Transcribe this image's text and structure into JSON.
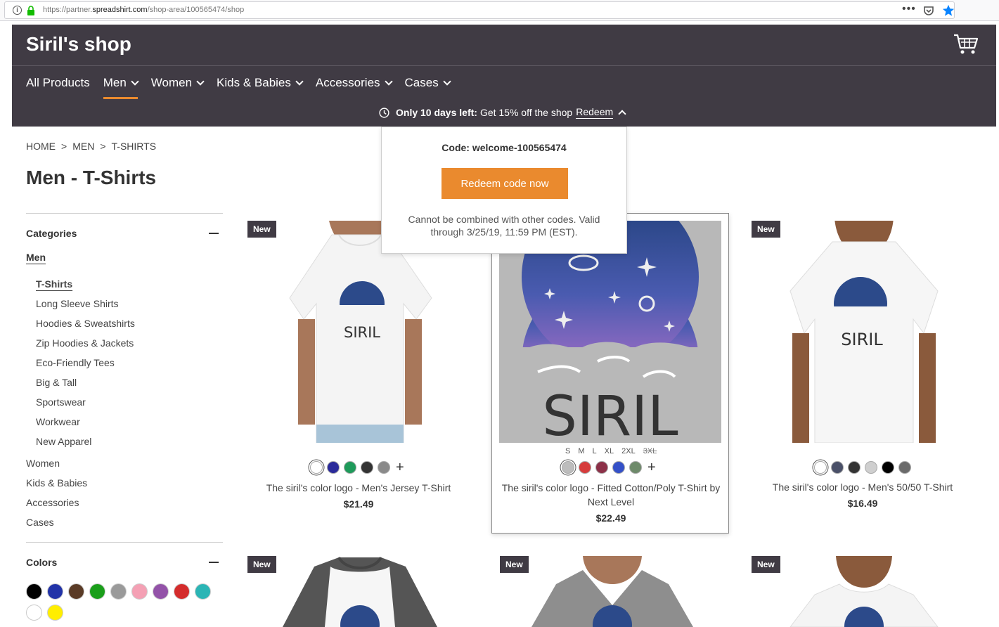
{
  "browser": {
    "url_prefix": "https://partner.",
    "url_domain": "spreadshirt.com",
    "url_path": "/shop-area/100565474/shop",
    "menu_dots": "•••"
  },
  "header": {
    "shop_title": "Siril's shop",
    "nav": [
      "All Products",
      "Men",
      "Women",
      "Kids & Babies",
      "Accessories",
      "Cases"
    ],
    "promo_bold": "Only 10 days left:",
    "promo_text": "Get 15% off the shop",
    "promo_link": "Redeem"
  },
  "popover": {
    "code": "Code: welcome-100565474",
    "button": "Redeem code now",
    "note": "Cannot be combined with other codes. Valid through 3/25/19, 11:59 PM (EST)."
  },
  "breadcrumb": [
    "HOME",
    ">",
    "MEN",
    ">",
    "T-SHIRTS"
  ],
  "page_title": "Men - T-Shirts",
  "sidebar": {
    "categories_heading": "Categories",
    "main_category": "Men",
    "sub_categories": [
      "T-Shirts",
      "Long Sleeve Shirts",
      "Hoodies & Sweatshirts",
      "Zip Hoodies & Jackets",
      "Eco-Friendly Tees",
      "Big & Tall",
      "Sportswear",
      "Workwear",
      "New Apparel"
    ],
    "top_categories": [
      "Women",
      "Kids & Babies",
      "Accessories",
      "Cases"
    ],
    "colors_heading": "Colors",
    "colors": [
      "#000000",
      "#2233a8",
      "#5a3b26",
      "#1a9e1a",
      "#9a9a9a",
      "#f4a0b4",
      "#9352a8",
      "#d42c2c",
      "#2bb5b5",
      "#ffffff",
      "#ffee00"
    ]
  },
  "products": [
    {
      "badge": "New",
      "name": "The siril's color logo - Men's Jersey T-Shirt",
      "price": "$21.49",
      "swatches": [
        "#ffffff",
        "#2a2a9a",
        "#1e9a5a",
        "#333333",
        "#8a8a8a"
      ],
      "more": "+"
    },
    {
      "badge": "",
      "name": "The siril's color logo - Fitted Cotton/Poly T-Shirt by Next Level",
      "price": "$22.49",
      "sizes": [
        "S",
        "M",
        "L",
        "XL",
        "2XL",
        "3XL"
      ],
      "swatches": [
        "#bdbdbd",
        "#d63c3c",
        "#8c3048",
        "#3450c8",
        "#6e8a6a"
      ],
      "more": "+"
    },
    {
      "badge": "New",
      "name": "The siril's color logo - Men's 50/50 T-Shirt",
      "price": "$16.49",
      "swatches": [
        "#ffffff",
        "#4a5068",
        "#333333",
        "#cfcfcf",
        "#000000",
        "#6a6a6a"
      ]
    },
    {
      "badge": "New"
    },
    {
      "badge": "New"
    },
    {
      "badge": "New"
    }
  ]
}
